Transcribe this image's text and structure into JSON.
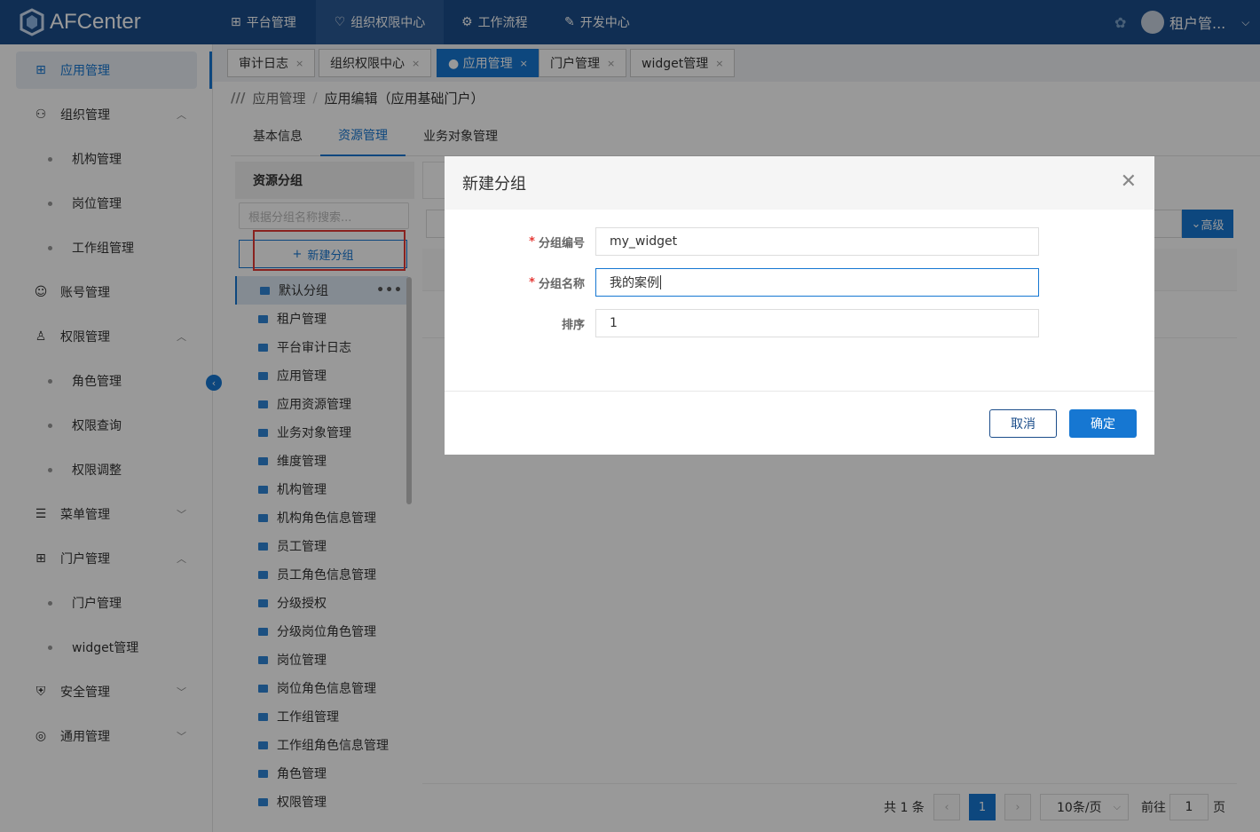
{
  "app": {
    "name": "AFCenter"
  },
  "topnav": [
    {
      "label": "平台管理",
      "icon": "grid-icon"
    },
    {
      "label": "组织权限中心",
      "icon": "shield-icon"
    },
    {
      "label": "工作流程",
      "icon": "flow-icon"
    },
    {
      "label": "开发中心",
      "icon": "edit-icon"
    }
  ],
  "user": {
    "name": "租户管..."
  },
  "sidebar": {
    "app_manage": "应用管理",
    "org_manage": "组织管理",
    "org_sub": [
      "机构管理",
      "岗位管理",
      "工作组管理"
    ],
    "account_manage": "账号管理",
    "perm_manage": "权限管理",
    "perm_sub": [
      "角色管理",
      "权限查询",
      "权限调整"
    ],
    "menu_manage": "菜单管理",
    "portal_manage": "门户管理",
    "portal_sub": [
      "门户管理",
      "widget管理"
    ],
    "security_manage": "安全管理",
    "common_manage": "通用管理"
  },
  "page_tabs": [
    "审计日志",
    "组织权限中心",
    "● 应用管理",
    "门户管理",
    "widget管理"
  ],
  "breadcrumb": {
    "root": "应用管理",
    "sep": "/",
    "current": "应用编辑（应用基础门户）"
  },
  "inner_tabs": [
    "基本信息",
    "资源管理",
    "业务对象管理"
  ],
  "resource_group": {
    "title": "资源分组",
    "search_placeholder": "根据分组名称搜索...",
    "new_button": "新建分组",
    "items": [
      "默认分组",
      "租户管理",
      "平台审计日志",
      "应用管理",
      "应用资源管理",
      "业务对象管理",
      "维度管理",
      "机构管理",
      "机构角色信息管理",
      "员工管理",
      "员工角色信息管理",
      "分级授权",
      "分级岗位角色管理",
      "岗位管理",
      "岗位角色信息管理",
      "工作组管理",
      "工作组角色信息管理",
      "角色管理",
      "权限管理"
    ]
  },
  "right": {
    "advanced_button": "高级"
  },
  "pagination": {
    "total": "共 1 条",
    "current": "1",
    "page_size": "10条/页",
    "goto_prefix": "前往",
    "goto_value": "1",
    "goto_suffix": "页"
  },
  "modal": {
    "title": "新建分组",
    "fields": [
      {
        "label": "分组编号",
        "required": true,
        "value": "my_widget"
      },
      {
        "label": "分组名称",
        "required": true,
        "value": "我的案例"
      },
      {
        "label": "排序",
        "required": false,
        "value": "1"
      }
    ],
    "cancel": "取消",
    "confirm": "确定"
  }
}
